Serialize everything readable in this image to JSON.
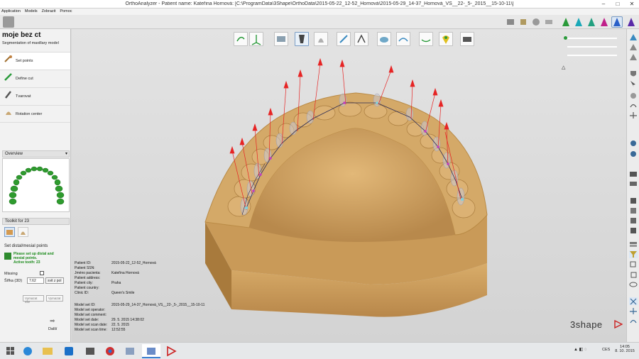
{
  "window": {
    "title": "OrthoAnalyzer - Patient name: Kateřina Hornová: [C:\\ProgramData\\3Shape\\OrthoData\\2015-05-22_12-52_Hornová\\2015-05-29_14-37_Hornová_VS__22-_5-_2015__15-10-11\\]",
    "minimize": "–",
    "maximize": "□",
    "close": "✕"
  },
  "menu": {
    "items": [
      "Application",
      "Models",
      "Zobrazit",
      "Pomoc"
    ]
  },
  "left_panel": {
    "title": "moje bez ct",
    "subtitle": "Segmentation of maxillary model",
    "steps": [
      {
        "label": "Set points",
        "icon": "set-points-icon"
      },
      {
        "label": "Define cut",
        "icon": "define-cut-icon"
      },
      {
        "label": "Tvarovat",
        "icon": "sculpt-icon"
      },
      {
        "label": "Rotation center",
        "icon": "rotation-center-icon"
      }
    ],
    "overview": {
      "label": "Overview",
      "collapse": "▾"
    },
    "toolkit": {
      "label": "Toolkit for 23"
    },
    "distal": {
      "label": "Set distal/mesial points",
      "instruction_1": "Please set up distal and",
      "instruction_2": "mesial points.",
      "active_tooth": "Active tooth: 23",
      "missing_label": "Missing",
      "width_label": "Šířka (3D)",
      "width_value": "7.62",
      "fit_button": "svit z pol",
      "clear_button_1": "Vymazat vše",
      "clear_button_2": "Vymazat"
    },
    "next": {
      "label": "Další",
      "arrow": "➡"
    }
  },
  "colors": {
    "tooth_green": "#2e9b2e",
    "model_fill": "#d4a968",
    "model_shade": "#b98a45",
    "arrow_red": "#e62424",
    "highlight_blue": "#7a9cc4"
  },
  "info": {
    "rows": [
      {
        "k": "Patient ID:",
        "v": "2015-05-22_12-52_Hornová"
      },
      {
        "k": "Patient SSN:",
        "v": ""
      },
      {
        "k": "Jméno pacienta:",
        "v": "Kateřina Hornová"
      },
      {
        "k": "Patient address:",
        "v": ""
      },
      {
        "k": "Patient city:",
        "v": "Praha"
      },
      {
        "k": "Patient country:",
        "v": ""
      },
      {
        "k": "Clinic ID:",
        "v": "Queen's Smile"
      }
    ],
    "rows2": [
      {
        "k": "Model set ID:",
        "v": "2015-05-29_14-37_Hornová_VS__22-_5-_2015__15-10-11"
      },
      {
        "k": "Model set operator:",
        "v": ""
      },
      {
        "k": "Model set comment:",
        "v": ""
      },
      {
        "k": "Model set date:",
        "v": "29. 5. 2015 14:38:02"
      },
      {
        "k": "Model set scan date:",
        "v": "22. 5. 2015"
      },
      {
        "k": "Model set scan time:",
        "v": "12:52:55"
      }
    ]
  },
  "brand": "3shape",
  "taskbar": {
    "lang": "CES",
    "time": "14:05",
    "date": "8. 10. 2015"
  }
}
